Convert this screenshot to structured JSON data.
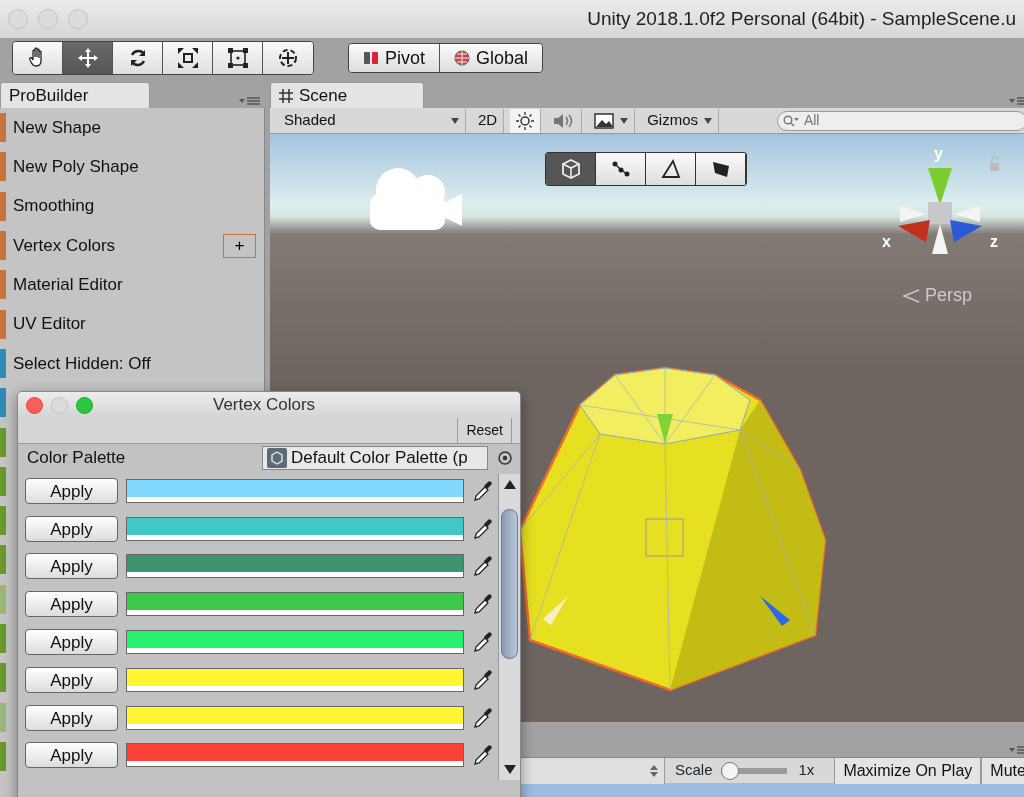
{
  "window": {
    "title": "Unity 2018.1.0f2 Personal (64bit) - SampleScene.u"
  },
  "toolbar": {
    "tools": [
      {
        "kind": "hand",
        "selected": false
      },
      {
        "kind": "move",
        "selected": true
      },
      {
        "kind": "rotate",
        "selected": false
      },
      {
        "kind": "scale",
        "selected": false
      },
      {
        "kind": "rect",
        "selected": false
      },
      {
        "kind": "transform",
        "selected": false
      }
    ],
    "pivot": "Pivot",
    "global": "Global"
  },
  "probuilder": {
    "tab": "ProBuilder",
    "items": [
      {
        "label": "New Shape",
        "color": "#c8743c",
        "disabled": false
      },
      {
        "label": "New Poly Shape",
        "color": "#c8743c",
        "disabled": false
      },
      {
        "label": "Smoothing",
        "color": "#c8743c",
        "disabled": false
      },
      {
        "label": "Vertex Colors",
        "color": "#c8743c",
        "disabled": false,
        "options": "+"
      },
      {
        "label": "Material Editor",
        "color": "#c8743c",
        "disabled": false
      },
      {
        "label": "UV Editor",
        "color": "#c8743c",
        "disabled": false
      },
      {
        "label": "Select Hidden: Off",
        "color": "#2e8bb8",
        "disabled": false
      },
      {
        "color": "#2e8bb8"
      },
      {
        "color": "#6a9a28"
      },
      {
        "color": "#6a9a28"
      },
      {
        "color": "#6a9a28"
      },
      {
        "color": "#6a9a28"
      },
      {
        "color": "#9ab878"
      },
      {
        "color": "#6a9a28"
      },
      {
        "color": "#6a9a28"
      },
      {
        "color": "#9ab878"
      },
      {
        "color": "#6a9a28"
      }
    ]
  },
  "scene": {
    "tab": "Scene",
    "shading": "Shaded",
    "mode_2d": "2D",
    "lighting_on": true,
    "audio_on": false,
    "effects_on": false,
    "gizmos": "Gizmos",
    "search_placeholder": "All",
    "modes": [
      {
        "kind": "object",
        "selected": true
      },
      {
        "kind": "vertex",
        "selected": false
      },
      {
        "kind": "edge",
        "selected": false
      },
      {
        "kind": "face",
        "selected": false
      }
    ],
    "axis_labels": [
      "y",
      "x",
      "z"
    ],
    "projection": "Persp"
  },
  "game": {
    "scale_label": "Scale",
    "scale": {
      "level": 0
    },
    "scale_value": "1x",
    "buttons": [
      "Maximize On Play",
      "Mute"
    ]
  },
  "vertex_colors": {
    "title": "Vertex Colors",
    "reset": "Reset",
    "palette_label": "Color Palette",
    "palette_value": "Default Color Palette (p",
    "rows": [
      {
        "label": "Apply",
        "color": "#80d8fc"
      },
      {
        "label": "Apply",
        "color": "#40c8c8"
      },
      {
        "label": "Apply",
        "color": "#3e9470"
      },
      {
        "label": "Apply",
        "color": "#3cc84a"
      },
      {
        "label": "Apply",
        "color": "#28f070"
      },
      {
        "label": "Apply",
        "color": "#fff533"
      },
      {
        "label": "Apply",
        "color": "#fff533"
      },
      {
        "label": "Apply",
        "color": "#fb4038"
      }
    ]
  }
}
